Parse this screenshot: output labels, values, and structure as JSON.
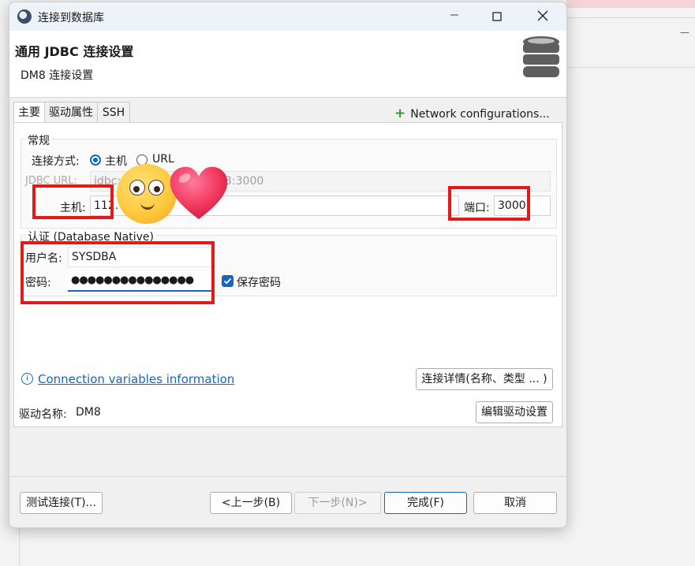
{
  "window": {
    "title": "连接到数据库"
  },
  "header": {
    "title": "通用 JDBC 连接设置",
    "subtitle": "DM8 连接设置"
  },
  "tabs": [
    {
      "label": "主要",
      "active": true
    },
    {
      "label": "驱动属性",
      "active": false
    },
    {
      "label": "SSH",
      "active": false
    }
  ],
  "network_config_label": "Network configurations...",
  "general": {
    "group_label": "常规",
    "connect_mode_label": "连接方式:",
    "mode_host_label": "主机",
    "mode_url_label": "URL",
    "selected_mode": "主机",
    "jdbc_url_label": "JDBC URL:",
    "jdbc_url_prefix": "jdbc:",
    "jdbc_url_suffix": "3:3000",
    "host_label": "主机:",
    "host_value": "112.",
    "port_label": "端口:",
    "port_value": "3000"
  },
  "auth": {
    "group_label": "认证 (Database Native)",
    "username_label": "用户名:",
    "username_value": "SYSDBA",
    "password_label": "密码:",
    "password_value": "●●●●●●●●●●●●●●●",
    "save_password_label": "保存密码",
    "save_password_checked": true
  },
  "connection_variables_link": "Connection variables information",
  "connection_details_button": "连接详情(名称、类型 ... )",
  "driver": {
    "name_label": "驱动名称:",
    "name_value": "DM8",
    "edit_button": "编辑驱动设置"
  },
  "footer": {
    "test_button": "测试连接(T)...",
    "back_button": "<上一步(B)",
    "next_button": "下一步(N)>",
    "finish_button": "完成(F)",
    "cancel_button": "取消"
  },
  "colors": {
    "accent": "#1566c0",
    "annotation_red": "#e31a1a",
    "add_green": "#2e9b35"
  },
  "icons": [
    "app-icon",
    "minimize-icon",
    "maximize-icon",
    "close-icon",
    "database-icon",
    "plus-icon",
    "info-icon",
    "checkmark-icon",
    "smiley-emoji",
    "heart-emoji"
  ]
}
